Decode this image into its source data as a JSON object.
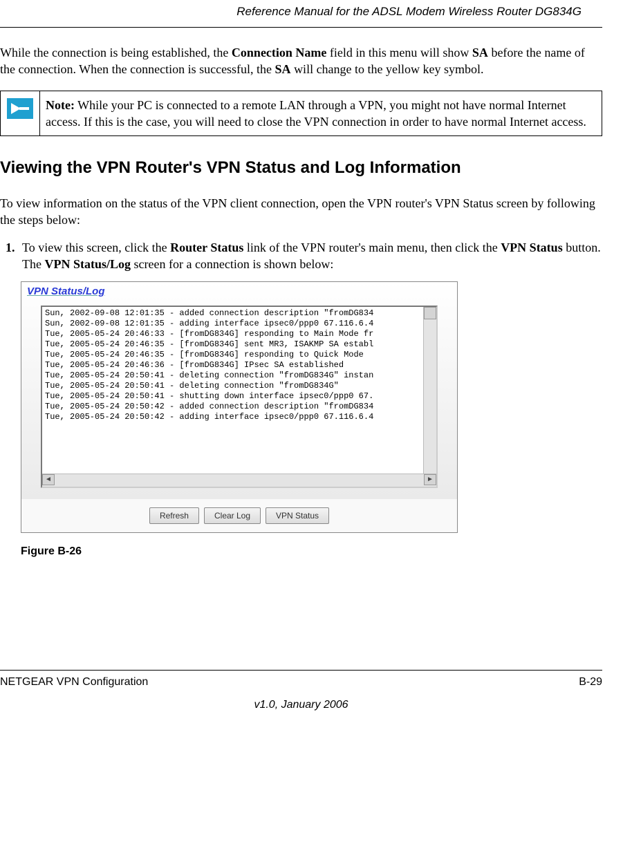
{
  "header": {
    "title": "Reference Manual for the ADSL Modem Wireless Router DG834G"
  },
  "intro": {
    "text_parts": [
      "While the connection is being established, the ",
      "Connection Name",
      " field in this menu will show ",
      "SA",
      " before the name of the connection. When the connection is successful, the ",
      "SA",
      " will change to the yellow key symbol."
    ]
  },
  "note": {
    "label": "Note:",
    "text": " While your PC is connected to a remote LAN through a VPN, you might not have normal Internet access. If this is the case, you will need to close the VPN connection in order to have normal Internet access."
  },
  "section_heading": "Viewing the VPN Router's VPN Status and Log Information",
  "section_intro": "To view information on the status of the VPN client connection, open the VPN router's VPN Status screen by following the steps below:",
  "step1": {
    "parts": [
      "To view this screen, click the ",
      "Router Status",
      " link of the VPN router's main menu, then click the ",
      "VPN Status",
      " button. The ",
      "VPN Status/Log",
      " screen for a connection is shown below:"
    ]
  },
  "screenshot": {
    "title": "VPN Status/Log",
    "log_lines": [
      "Sun, 2002-09-08 12:01:35 - added connection description \"fromDG834",
      "Sun, 2002-09-08 12:01:35 - adding interface ipsec0/ppp0 67.116.6.4",
      "Tue, 2005-05-24 20:46:33 - [fromDG834G] responding to Main Mode fr",
      "Tue, 2005-05-24 20:46:35 - [fromDG834G] sent MR3, ISAKMP SA establ",
      "Tue, 2005-05-24 20:46:35 - [fromDG834G] responding to Quick Mode",
      "Tue, 2005-05-24 20:46:36 - [fromDG834G] IPsec SA established",
      "Tue, 2005-05-24 20:50:41 - deleting connection \"fromDG834G\" instan",
      "Tue, 2005-05-24 20:50:41 - deleting connection \"fromDG834G\"",
      "Tue, 2005-05-24 20:50:41 - shutting down interface ipsec0/ppp0 67.",
      "Tue, 2005-05-24 20:50:42 - added connection description \"fromDG834",
      "Tue, 2005-05-24 20:50:42 - adding interface ipsec0/ppp0 67.116.6.4"
    ],
    "buttons": {
      "refresh": "Refresh",
      "clear_log": "Clear Log",
      "vpn_status": "VPN Status"
    }
  },
  "figure_caption": "Figure B-26",
  "footer": {
    "left": "NETGEAR VPN Configuration",
    "right": "B-29",
    "version": "v1.0, January 2006"
  }
}
